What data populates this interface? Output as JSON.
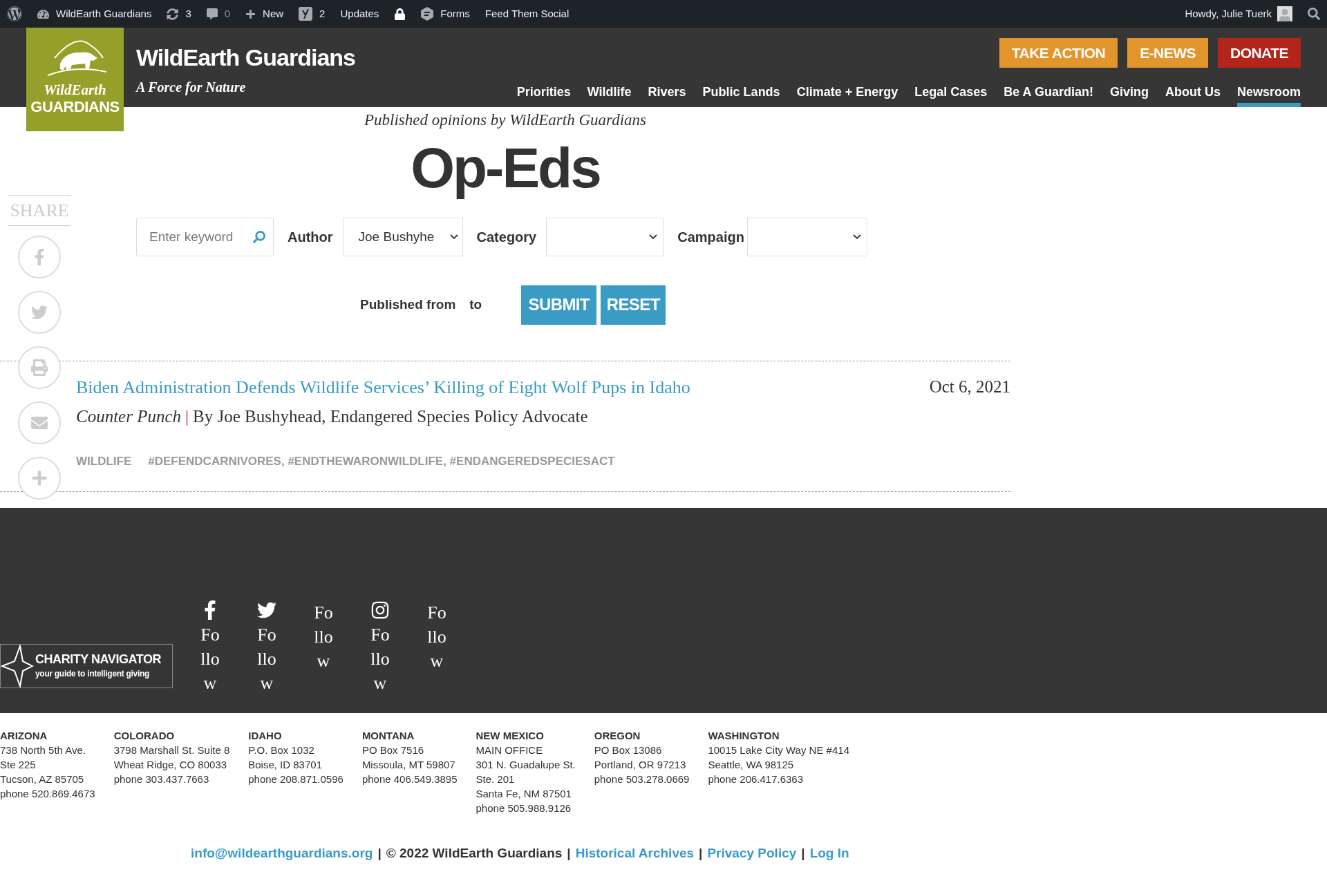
{
  "admin_bar": {
    "items": [
      {
        "kind": "icon"
      },
      {
        "label": "WildEarth Guardians",
        "dim": false
      },
      {
        "label": "3",
        "dim": false
      },
      {
        "label": "0",
        "dim": true
      },
      {
        "label": "New",
        "dim": false
      },
      {
        "label": "2",
        "dim": false
      },
      {
        "label": "Updates",
        "dim": false
      },
      {
        "kind": "icon"
      },
      {
        "label": "Forms",
        "dim": false
      },
      {
        "label": "Feed Them Social",
        "dim": false
      }
    ],
    "greeting": "Howdy, Julie Tuerk"
  },
  "header": {
    "logo": {
      "line1": "WildEarth",
      "line2": "GUARDIANS"
    },
    "site_title": "WildEarth Guardians",
    "tagline": "A Force for Nature",
    "buttons": [
      {
        "label": "TAKE ACTION",
        "color": "#e3952d"
      },
      {
        "label": "E-NEWS",
        "color": "#e3952d"
      },
      {
        "label": "DONATE",
        "color": "#b3241b"
      }
    ],
    "nav": [
      {
        "label": "Priorities",
        "selected": false
      },
      {
        "label": "Wildlife",
        "selected": false
      },
      {
        "label": "Rivers",
        "selected": false
      },
      {
        "label": "Public Lands",
        "selected": false
      },
      {
        "label": "Climate + Energy",
        "selected": false
      },
      {
        "label": "Legal Cases",
        "selected": false
      },
      {
        "label": "Be A Guardian!",
        "selected": false
      },
      {
        "label": "Giving",
        "selected": false
      },
      {
        "label": "About Us",
        "selected": false
      },
      {
        "label": "Newsroom",
        "selected": true
      }
    ]
  },
  "share": {
    "label": "SHARE"
  },
  "page": {
    "subtitle": "Published opinions by WildEarth Guardians",
    "title": "Op-Eds"
  },
  "filters": {
    "keyword": {
      "placeholder": "Enter keyword"
    },
    "author": {
      "label": "Author",
      "value": "Joe Bushyhe"
    },
    "category": {
      "label": "Category"
    },
    "campaign": {
      "label": "Campaign"
    },
    "published_from": "Published from",
    "to": "to",
    "submit": "SUBMIT",
    "reset": "RESET"
  },
  "articles": [
    {
      "title": "Biden Administration Defends Wildlife Services’ Killing of Eight Wolf Pups in Idaho",
      "date": "Oct 6, 2021",
      "source": "Counter Punch",
      "separator": "|",
      "byline": "By Joe Bushyhead, Endangered Species Policy Advocate",
      "category": "WILDLIFE",
      "tags": "#DEFENDCARNIVORES, #ENDTHEWARONWILDLIFE, #ENDANGEREDSPECIESACT"
    }
  ],
  "footer": {
    "follow": [
      {
        "label": "Follow"
      },
      {
        "label": "Follow"
      },
      {
        "label": "Follow"
      },
      {
        "label": "Follow"
      },
      {
        "label": "Follow"
      }
    ],
    "charity_navigator": {
      "name": "CHARITY NAVIGATOR",
      "slogan": "your guide to intelligent giving"
    },
    "offices": [
      {
        "state": "ARIZONA",
        "lines": [
          "738 North 5th Ave.",
          "Ste 225",
          "Tucson, AZ 85705",
          "phone 520.869.4673"
        ]
      },
      {
        "state": "COLORADO",
        "lines": [
          "3798 Marshall St. Suite 8",
          "Wheat Ridge, CO 80033",
          "phone 303.437.7663"
        ]
      },
      {
        "state": "IDAHO",
        "lines": [
          "P.O. Box 1032",
          "Boise, ID 83701",
          "phone 208.871.0596"
        ]
      },
      {
        "state": "MONTANA",
        "lines": [
          "PO Box 7516",
          "Missoula, MT 59807",
          "phone 406.549.3895"
        ]
      },
      {
        "state": "NEW MEXICO",
        "lines": [
          "MAIN OFFICE",
          "301 N. Guadalupe St.",
          "Ste. 201",
          "Santa Fe, NM 87501",
          "phone 505.988.9126"
        ]
      },
      {
        "state": "OREGON",
        "lines": [
          "PO Box 13086",
          "Portland, OR 97213",
          "phone 503.278.0669"
        ]
      },
      {
        "state": "WASHINGTON",
        "lines": [
          "10015 Lake City Way NE #414",
          "Seattle, WA 98125",
          "phone 206.417.6363"
        ]
      }
    ],
    "bottom": [
      {
        "kind": "link",
        "text": "info@wildearthguardians.org"
      },
      {
        "kind": "sep",
        "text": "|"
      },
      {
        "kind": "text",
        "text": "© 2022 WildEarth Guardians"
      },
      {
        "kind": "sep",
        "text": "|"
      },
      {
        "kind": "link",
        "text": "Historical Archives"
      },
      {
        "kind": "sep",
        "text": "|"
      },
      {
        "kind": "link",
        "text": "Privacy Policy"
      },
      {
        "kind": "sep",
        "text": "|"
      },
      {
        "kind": "link",
        "text": "Log In"
      }
    ]
  }
}
